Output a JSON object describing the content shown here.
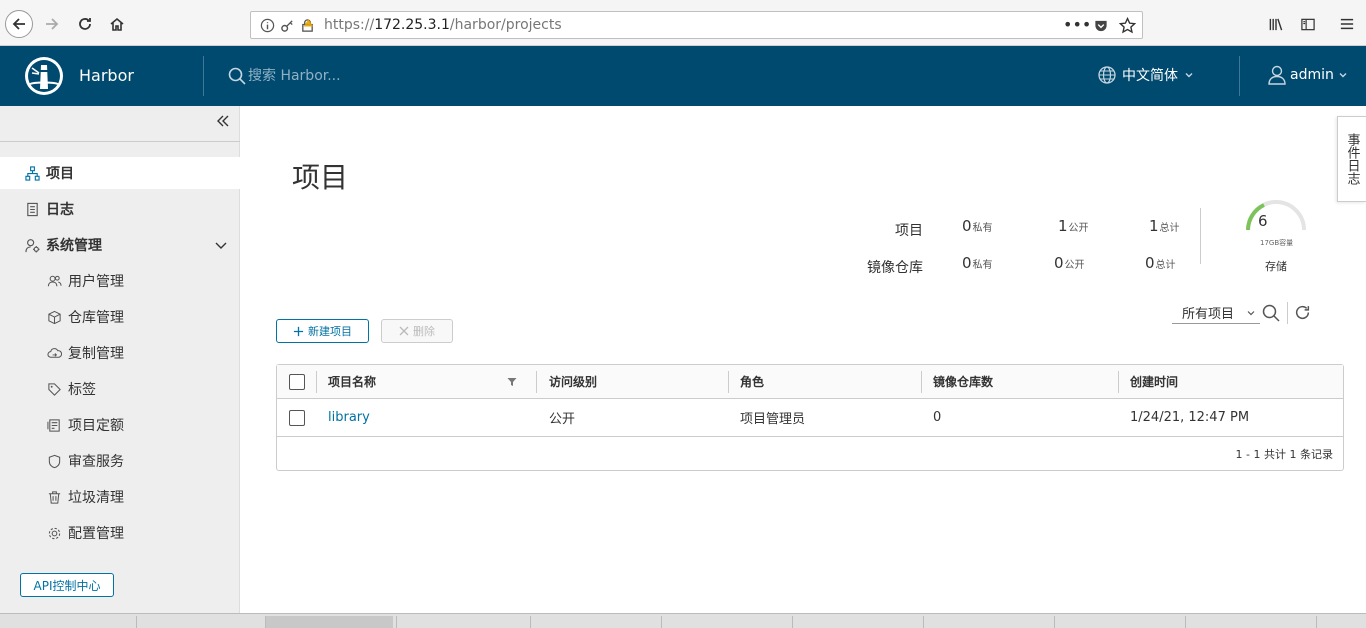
{
  "browser": {
    "url_prefix": "https://",
    "url_host": "172.25.3.1",
    "url_path": "/harbor/projects"
  },
  "header": {
    "brand": "Harbor",
    "search_placeholder": "搜索 Harbor...",
    "language": "中文简体",
    "user": "admin",
    "bg_color": "#004a70"
  },
  "sidebar": {
    "items": [
      {
        "label": "项目",
        "icon": "project-icon"
      },
      {
        "label": "日志",
        "icon": "log-icon"
      },
      {
        "label": "系统管理",
        "icon": "admin-gear-icon"
      }
    ],
    "sub_items": [
      {
        "label": "用户管理",
        "icon": "users-icon"
      },
      {
        "label": "仓库管理",
        "icon": "box-icon"
      },
      {
        "label": "复制管理",
        "icon": "cloud-icon"
      },
      {
        "label": "标签",
        "icon": "tag-icon"
      },
      {
        "label": "项目定额",
        "icon": "quota-icon"
      },
      {
        "label": "审查服务",
        "icon": "shield-icon"
      },
      {
        "label": "垃圾清理",
        "icon": "trash-icon"
      },
      {
        "label": "配置管理",
        "icon": "gear-icon"
      }
    ],
    "api_button": "API控制中心"
  },
  "main": {
    "title": "项目",
    "event_log_tab": "事件日志",
    "stats": {
      "projects_label": "项目",
      "repos_label": "镜像仓库",
      "projects": {
        "private": "0",
        "public": "1",
        "total": "1"
      },
      "repos": {
        "private": "0",
        "public": "0",
        "total": "0"
      },
      "private_suffix": "私有",
      "public_suffix": "公开",
      "total_suffix": "总计",
      "storage_value": "6",
      "storage_caption": "17GB容量",
      "storage_label": "存储"
    },
    "filter": "所有项目",
    "new_button": "新建项目",
    "delete_button": "删除",
    "table": {
      "headers": [
        "项目名称",
        "访问级别",
        "角色",
        "镜像仓库数",
        "创建时间"
      ],
      "rows": [
        {
          "name": "library",
          "access": "公开",
          "role": "项目管理员",
          "repos": "0",
          "created": "1/24/21, 12:47 PM"
        }
      ],
      "footer": "1 - 1 共计 1 条记录"
    }
  }
}
